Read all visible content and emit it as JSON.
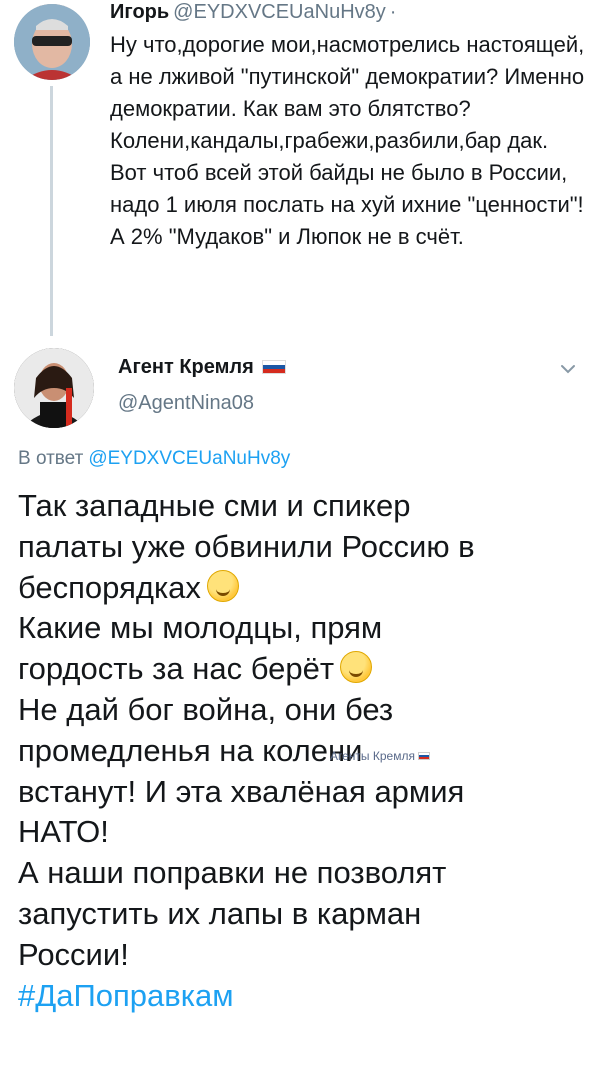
{
  "parent_tweet": {
    "author_name": "Игорь",
    "author_handle": "@EYDXVCEUaNuHv8y",
    "separator": "·",
    "text": "Ну что,дорогие мои,насмотрелись настоящей, а не лживой \"путинской\" демократии? Именно демократии. Как вам это блятство? Колени,кандалы,грабежи,разбили,бар дак. Вот чтоб всей этой байды не было в России, надо 1 июля послать на хуй ихние \"ценности\"! А 2% \"Мудаков\" и Люпок не в счёт."
  },
  "reply_tweet": {
    "author_name": "Агент Кремля",
    "author_handle": "@AgentNina08",
    "in_reply_to_label": "В ответ",
    "in_reply_to_handle": "@EYDXVCEUaNuHv8y",
    "lines": [
      "Так западные сми и спикер",
      "палаты уже обвинили Россию в",
      "беспорядках",
      "Какие мы молодцы, прям",
      "гордость за нас берёт",
      "Не дай бог война, они без",
      "промедленья на колени",
      "встанут! И эта хвалёная армия",
      "НАТО!",
      "А наши поправки не позволят",
      "запустить их лапы в карман",
      "России!"
    ],
    "hashtag": "#ДаПоправкам"
  },
  "watermark": {
    "text": "Агенты Кремля"
  },
  "icons": {
    "chevron": "chevron-down-icon",
    "flag": "russia-flag-icon",
    "emoji_1": "laughing-face-icon",
    "emoji_2": "grinning-face-icon"
  },
  "colors": {
    "link": "#1da1f2",
    "secondary_text": "#657786",
    "primary_text": "#14171a",
    "thread_line": "#ccd6dd"
  }
}
